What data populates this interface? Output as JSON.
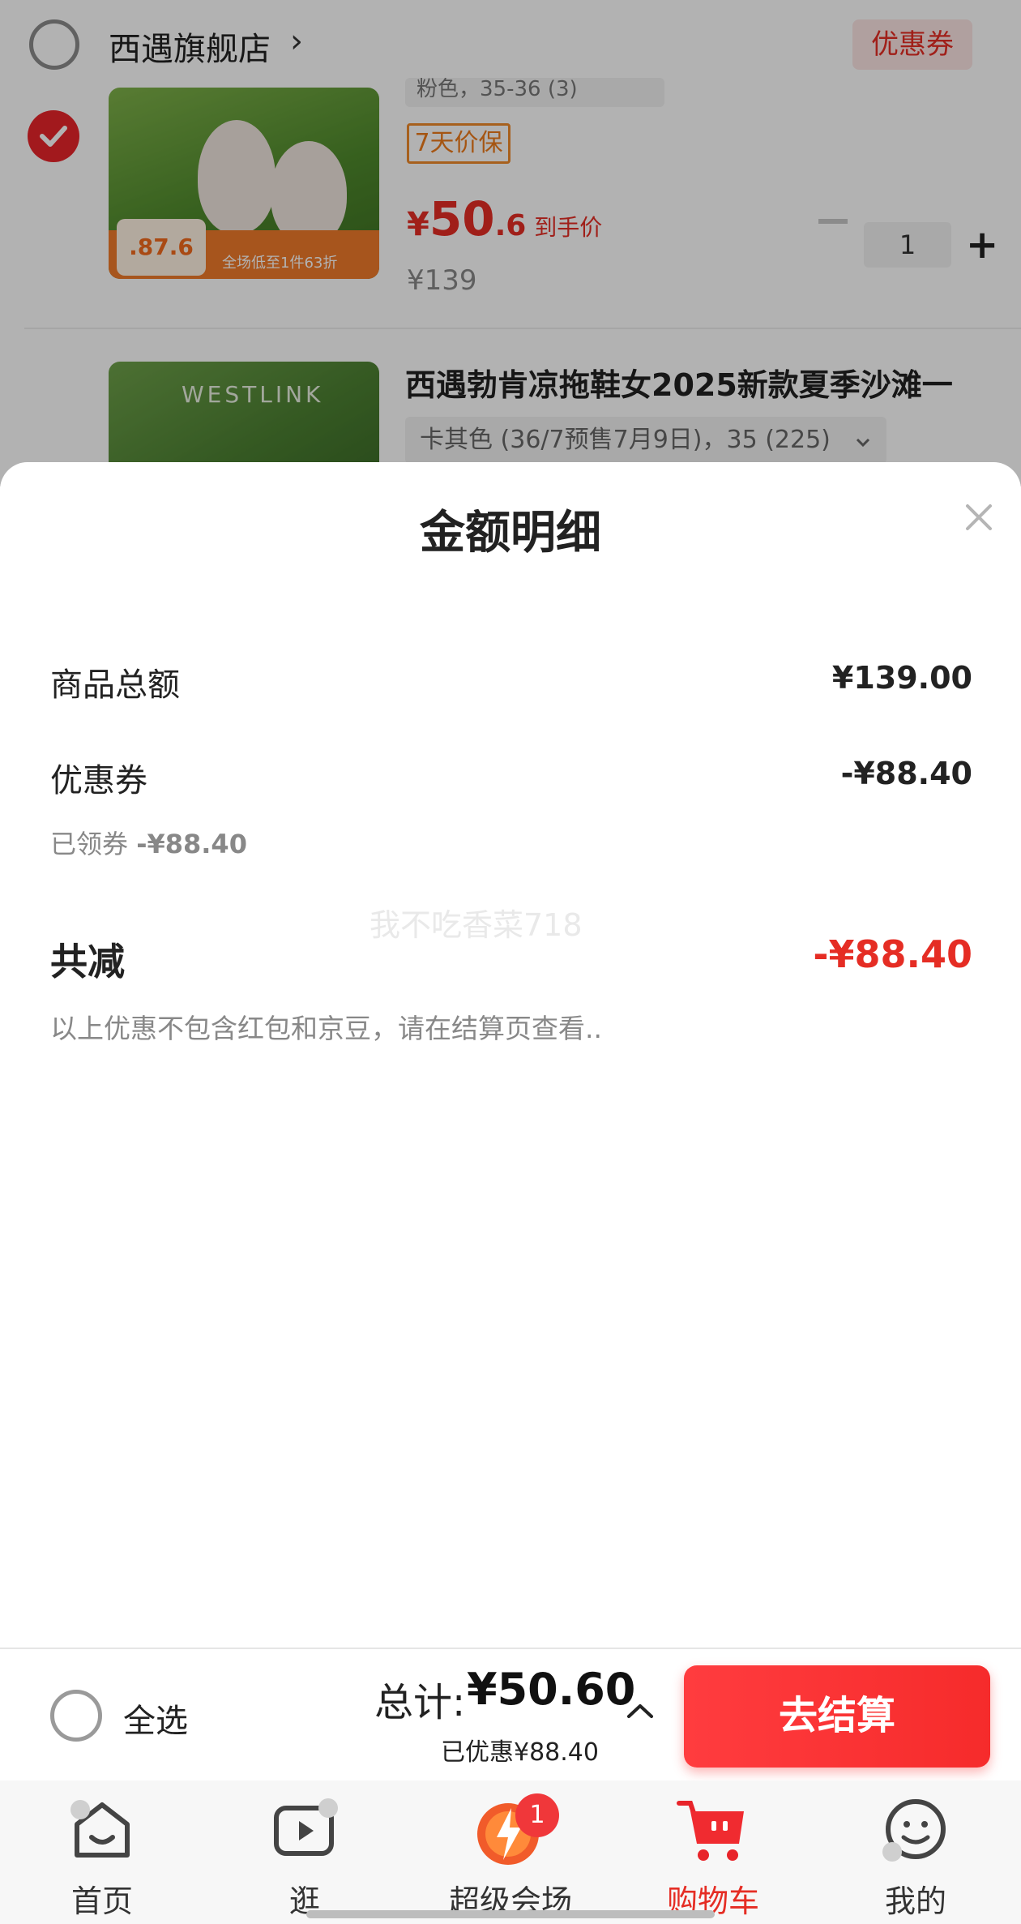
{
  "store": {
    "name": "西遇旗舰店",
    "arrow": "›",
    "coupon_chip": "优惠券"
  },
  "items": [
    {
      "spec": "粉色，35-36 (3)",
      "badge": "7天价保",
      "price_currency": "¥",
      "price_int": "50",
      "price_dec": ".6",
      "price_tag": "到手价",
      "orig_price": "¥139",
      "qty": "1",
      "img_badge": ".87.6",
      "img_strip": "全场低至1件63折"
    },
    {
      "title": "西遇勃肯凉拖鞋女2025新款夏季沙滩一",
      "spec": "卡其色 (36/7预售7月9日)，35 (225)",
      "img_brand": "WESTLINK"
    }
  ],
  "sheet": {
    "title": "金额明细",
    "goods_total_label": "商品总额",
    "goods_total_value": "¥139.00",
    "coupon_label": "优惠券",
    "coupon_value": "-¥88.40",
    "coupon_sub_label": "已领券",
    "coupon_sub_value": "-¥88.40",
    "total_reduce_label": "共减",
    "total_reduce_value": "-¥88.40",
    "note": "以上优惠不包含红包和京豆，请在结算页查看..",
    "watermark": "我不吃香菜718"
  },
  "checkout": {
    "select_all": "全选",
    "sum_label": "总计:",
    "sum_value": "¥50.60",
    "saved": "已优惠¥88.40",
    "pay_button": "去结算"
  },
  "tabs": [
    {
      "label": "首页",
      "icon": "home-icon"
    },
    {
      "label": "逛",
      "icon": "play-icon"
    },
    {
      "label": "超级会场",
      "icon": "super-venue-icon",
      "badge": "1"
    },
    {
      "label": "购物车",
      "icon": "cart-icon",
      "active": true
    },
    {
      "label": "我的",
      "icon": "profile-icon"
    }
  ],
  "colors": {
    "accent": "#e52d24",
    "button": "#f62b2b",
    "price_protect": "#ec7a1a"
  }
}
